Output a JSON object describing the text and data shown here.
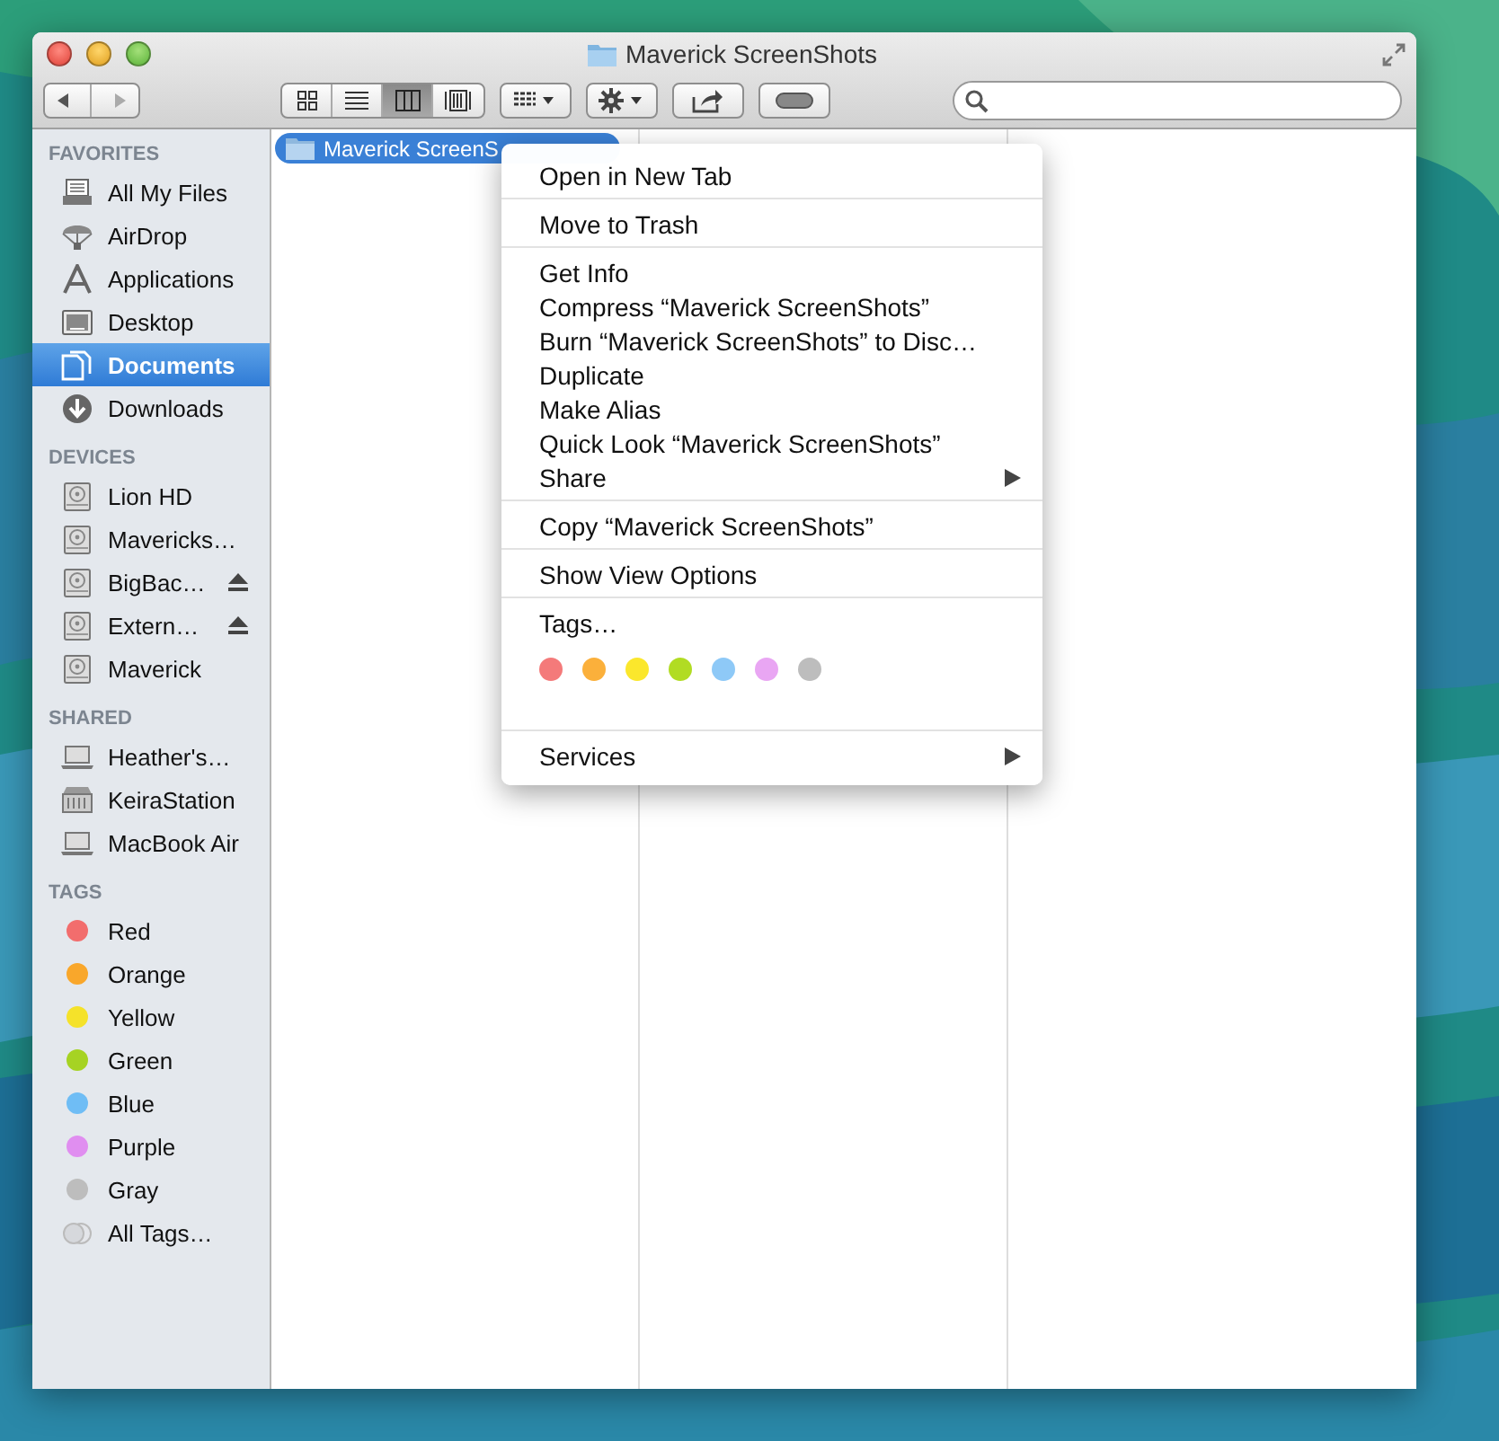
{
  "window": {
    "title": "Maverick ScreenShots"
  },
  "toolbar": {
    "view_modes": [
      {
        "selected": false
      },
      {
        "selected": false
      },
      {
        "selected": true
      },
      {
        "selected": false
      }
    ]
  },
  "sidebar": {
    "sections": [
      {
        "heading": "FAVORITES",
        "items": [
          {
            "label": "All My Files",
            "kind": "item",
            "selected": false
          },
          {
            "label": "AirDrop",
            "kind": "item",
            "selected": false
          },
          {
            "label": "Applications",
            "kind": "item",
            "selected": false
          },
          {
            "label": "Desktop",
            "kind": "item",
            "selected": false
          },
          {
            "label": "Documents",
            "kind": "item",
            "selected": true
          },
          {
            "label": "Downloads",
            "kind": "item",
            "selected": false
          }
        ]
      },
      {
        "heading": "DEVICES",
        "items": [
          {
            "label": "Lion HD",
            "kind": "item",
            "selected": false,
            "ejectable": false
          },
          {
            "label": "Mavericks…",
            "kind": "item",
            "selected": false,
            "ejectable": false
          },
          {
            "label": "BigBac…",
            "kind": "item",
            "selected": false,
            "ejectable": true
          },
          {
            "label": "Extern…",
            "kind": "item",
            "selected": false,
            "ejectable": true
          },
          {
            "label": "Maverick",
            "kind": "item",
            "selected": false,
            "ejectable": false
          }
        ]
      },
      {
        "heading": "SHARED",
        "items": [
          {
            "label": "Heather's…",
            "kind": "item",
            "selected": false
          },
          {
            "label": "KeiraStation",
            "kind": "item",
            "selected": false
          },
          {
            "label": "MacBook Air",
            "kind": "item",
            "selected": false
          }
        ]
      },
      {
        "heading": "TAGS",
        "items": [
          {
            "label": "Red",
            "kind": "tag",
            "color": "#f26d6d",
            "selected": false
          },
          {
            "label": "Orange",
            "kind": "tag",
            "color": "#f9a72b",
            "selected": false
          },
          {
            "label": "Yellow",
            "kind": "tag",
            "color": "#f5e22a",
            "selected": false
          },
          {
            "label": "Green",
            "kind": "tag",
            "color": "#a6d323",
            "selected": false
          },
          {
            "label": "Blue",
            "kind": "tag",
            "color": "#6fbdf5",
            "selected": false
          },
          {
            "label": "Purple",
            "kind": "tag",
            "color": "#e08ef0",
            "selected": false
          },
          {
            "label": "Gray",
            "kind": "tag",
            "color": "#bdbdbd",
            "selected": false
          },
          {
            "label": "All Tags…",
            "kind": "all-tags",
            "selected": false
          }
        ]
      }
    ]
  },
  "columns": [
    {
      "rows": [
        {
          "label": "Maverick ScreenS",
          "selected": true
        }
      ]
    }
  ],
  "context_menu": {
    "groups": [
      {
        "items": [
          {
            "label": "Open in New Tab",
            "submenu": false
          }
        ]
      },
      {
        "items": [
          {
            "label": "Move to Trash",
            "submenu": false
          }
        ]
      },
      {
        "items": [
          {
            "label": "Get Info",
            "submenu": false
          },
          {
            "label": "Compress “Maverick ScreenShots”",
            "submenu": false
          },
          {
            "label": "Burn “Maverick ScreenShots” to Disc…",
            "submenu": false
          },
          {
            "label": "Duplicate",
            "submenu": false
          },
          {
            "label": "Make Alias",
            "submenu": false
          },
          {
            "label": "Quick Look “Maverick ScreenShots”",
            "submenu": false
          },
          {
            "label": "Share",
            "submenu": true
          }
        ]
      },
      {
        "items": [
          {
            "label": "Copy “Maverick ScreenShots”",
            "submenu": false
          }
        ]
      },
      {
        "items": [
          {
            "label": "Show View Options",
            "submenu": false
          }
        ]
      },
      {
        "items": [
          {
            "label": "Tags…",
            "submenu": false
          }
        ],
        "tag_colors": [
          {
            "color": "#f47a7a"
          },
          {
            "color": "#fbb03b"
          },
          {
            "color": "#fbe72c"
          },
          {
            "color": "#b1dc23"
          },
          {
            "color": "#8ec9f7"
          },
          {
            "color": "#e9a6f3"
          },
          {
            "color": "#bdbdbd"
          }
        ]
      },
      {
        "items": [
          {
            "label": "Services",
            "submenu": true
          }
        ]
      }
    ]
  }
}
